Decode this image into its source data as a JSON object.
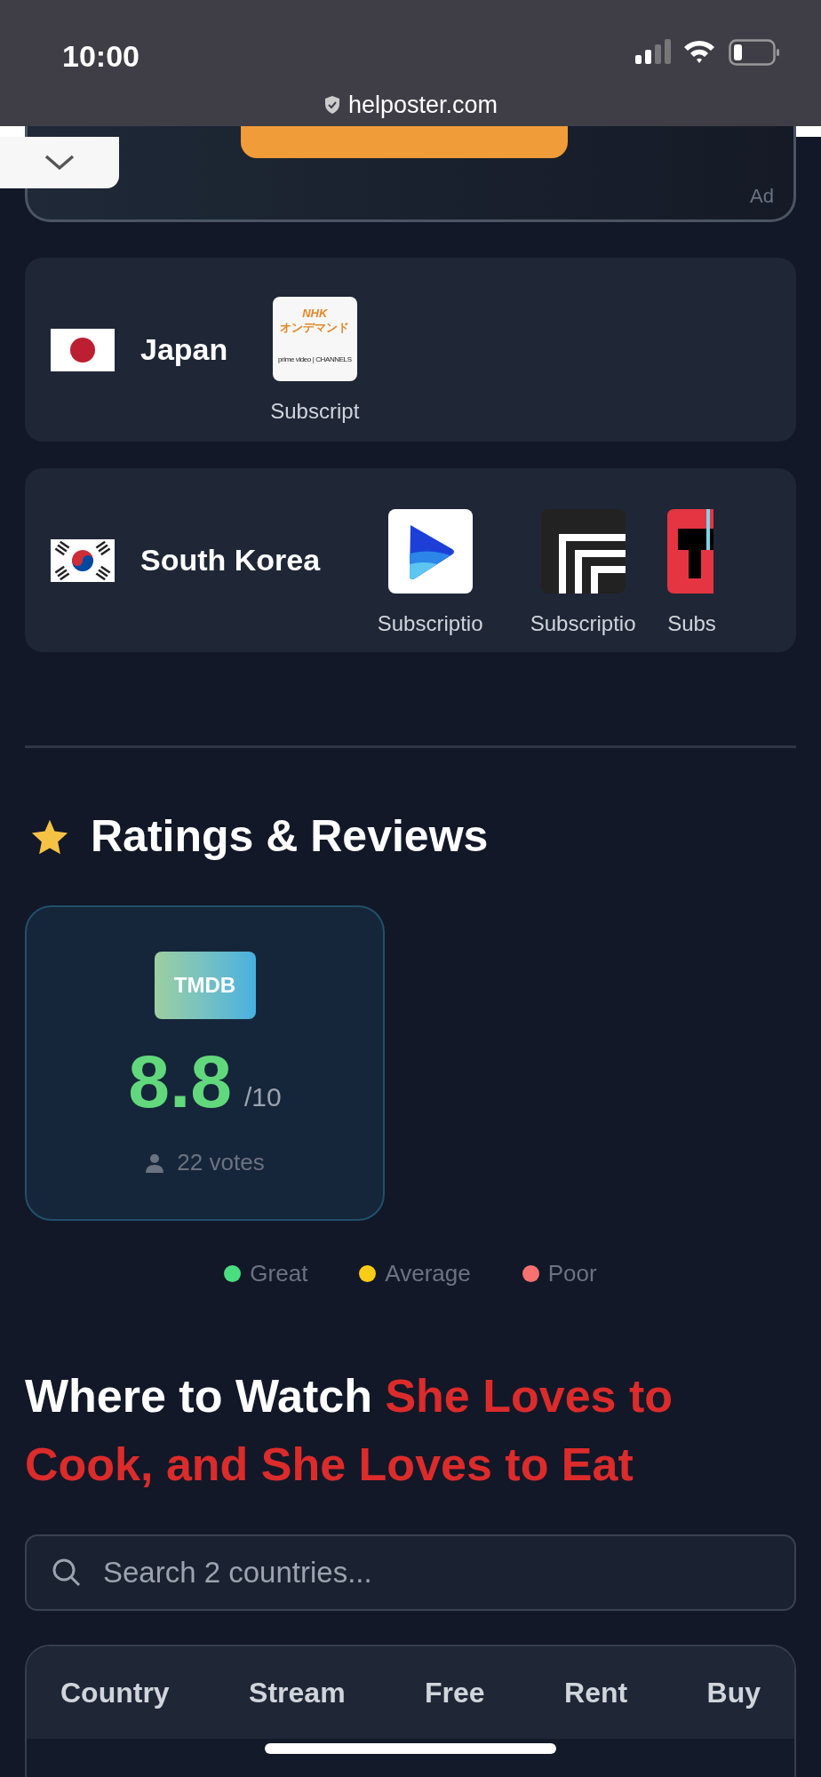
{
  "status_bar": {
    "time": "10:00"
  },
  "browser": {
    "url": "helposter.com"
  },
  "ad": {
    "label": "Ad"
  },
  "countries": [
    {
      "name": "Japan",
      "flag": {
        "kind": "japan"
      },
      "providers": [
        {
          "kind": "nhk",
          "label": "Subscript",
          "logo_lines": [
            "NHK",
            "オンデマンド",
            "prime video | CHANNELS"
          ]
        }
      ]
    },
    {
      "name": "South Korea",
      "flag": {
        "kind": "korea"
      },
      "providers": [
        {
          "kind": "play",
          "label": "Subscriptio"
        },
        {
          "kind": "frame",
          "label": "Subscriptio"
        },
        {
          "kind": "red",
          "label": "Subs"
        }
      ]
    }
  ],
  "ratings": {
    "heading": "Ratings & Reviews",
    "cards": [
      {
        "source": "TMDB",
        "score": "8.8",
        "scale": "/10",
        "votes": "22 votes",
        "color": "#62d87c"
      }
    ],
    "legend": [
      {
        "label": "Great",
        "color": "#4ade80"
      },
      {
        "label": "Average",
        "color": "#facc15"
      },
      {
        "label": "Poor",
        "color": "#f87171"
      }
    ]
  },
  "where_to_watch": {
    "title": "Where to Watch",
    "title_highlight": "She Loves to Cook, and She Loves to Eat"
  },
  "search": {
    "placeholder": "Search 2 countries..."
  },
  "table": {
    "columns": [
      "Country",
      "Stream",
      "Free",
      "Rent",
      "Buy"
    ]
  }
}
